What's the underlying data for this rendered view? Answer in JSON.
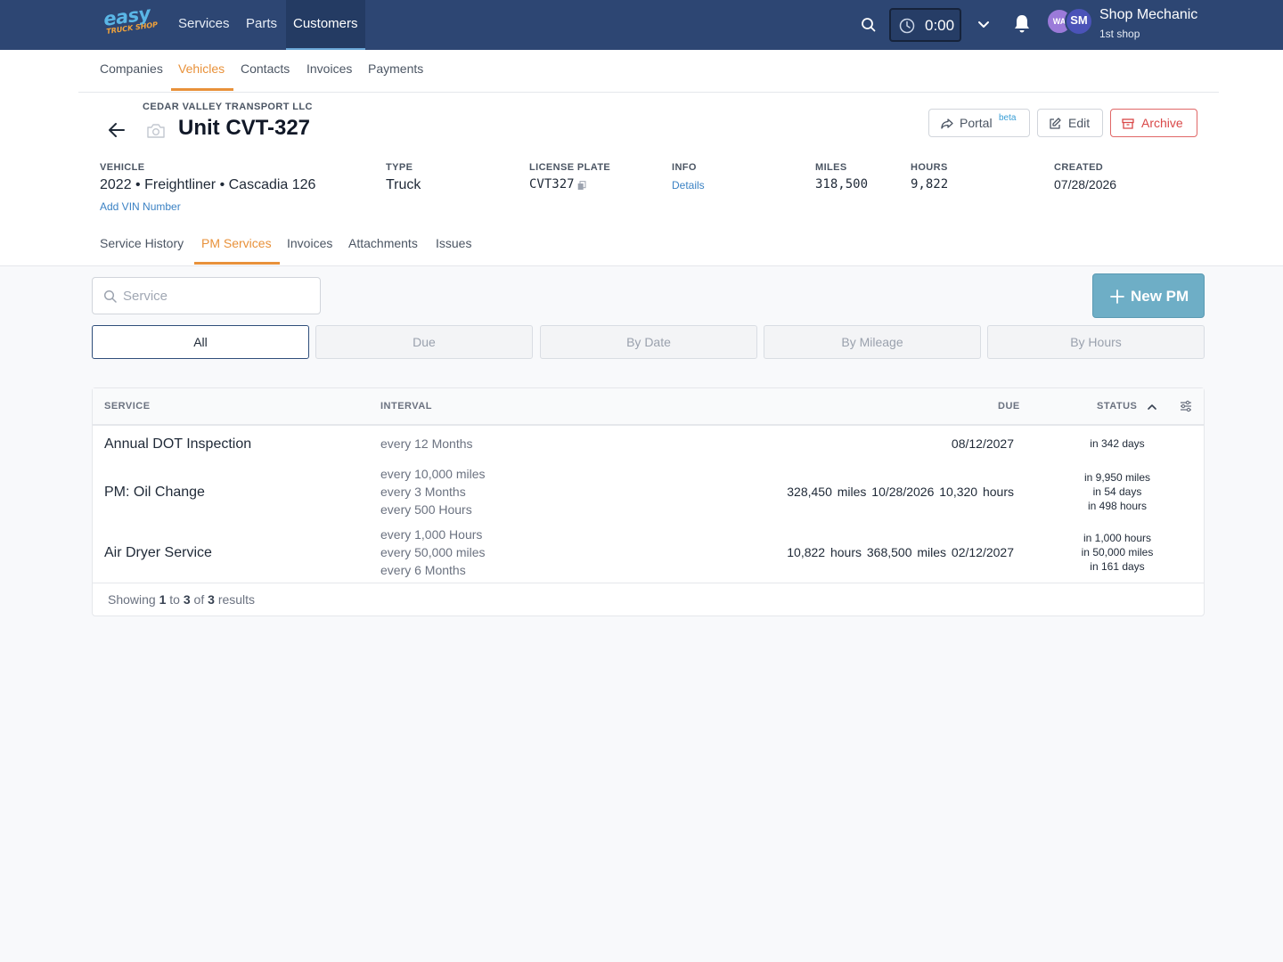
{
  "app": {
    "logo_main": "easy",
    "logo_sub": "TRUCK SHOP",
    "nav": [
      {
        "label": "Services"
      },
      {
        "label": "Parts"
      },
      {
        "label": "Customers"
      }
    ],
    "timer": "0:00",
    "user": {
      "initials_1": "WA",
      "initials_2": "SM",
      "name": "Shop Mechanic",
      "shop": "1st shop"
    }
  },
  "subnav": [
    {
      "label": "Companies"
    },
    {
      "label": "Vehicles"
    },
    {
      "label": "Contacts"
    },
    {
      "label": "Invoices"
    },
    {
      "label": "Payments"
    }
  ],
  "vehicle": {
    "company": "CEDAR VALLEY TRANSPORT LLC",
    "title": "Unit CVT-327",
    "actions": {
      "portal": "Portal",
      "portal_badge": "beta",
      "edit": "Edit",
      "archive": "Archive"
    },
    "meta": {
      "vehicle_label": "VEHICLE",
      "vehicle_value": "2022 • Freightliner • Cascadia 126",
      "add_vin": "Add VIN Number",
      "type_label": "TYPE",
      "type_value": "Truck",
      "plate_label": "LICENSE PLATE",
      "plate_value": "CVT327",
      "info_label": "INFO",
      "info_link": "Details",
      "miles_label": "MILES",
      "miles_value": "318,500",
      "hours_label": "HOURS",
      "hours_value": "9,822",
      "created_label": "CREATED",
      "created_value": "07/28/2026"
    }
  },
  "tabs": [
    {
      "label": "Service History"
    },
    {
      "label": "PM Services"
    },
    {
      "label": "Invoices"
    },
    {
      "label": "Attachments"
    },
    {
      "label": "Issues"
    }
  ],
  "search": {
    "placeholder": "Service",
    "value": ""
  },
  "new_pm": "New PM",
  "filters": [
    {
      "label": "All"
    },
    {
      "label": "Due"
    },
    {
      "label": "By Date"
    },
    {
      "label": "By Mileage"
    },
    {
      "label": "By Hours"
    }
  ],
  "table": {
    "headers": {
      "service": "SERVICE",
      "interval": "INTERVAL",
      "due": "DUE",
      "status": "STATUS"
    },
    "rows": [
      {
        "service": "Annual DOT Inspection",
        "intervals": [
          "every 12 Months"
        ],
        "due": "08/12/2027",
        "status": [
          "in 342 days"
        ]
      },
      {
        "service": "PM: Oil Change",
        "intervals": [
          "every 10,000 miles",
          "every 3 Months",
          "every 500 Hours"
        ],
        "due": "328,450 miles  10/28/2026  10,320 hours",
        "status": [
          "in 9,950 miles",
          "in 54 days",
          "in 498 hours"
        ]
      },
      {
        "service": "Air Dryer Service",
        "intervals": [
          "every 1,000 Hours",
          "every 50,000 miles",
          "every 6 Months"
        ],
        "due": "10,822 hours  368,500 miles  02/12/2027",
        "status": [
          "in 1,000 hours",
          "in 50,000 miles",
          "in 161 days"
        ]
      }
    ],
    "footer": {
      "prefix": "Showing",
      "from": "1",
      "to_word": "to",
      "to": "3",
      "of_word": "of",
      "total": "3",
      "suffix": "results"
    }
  }
}
